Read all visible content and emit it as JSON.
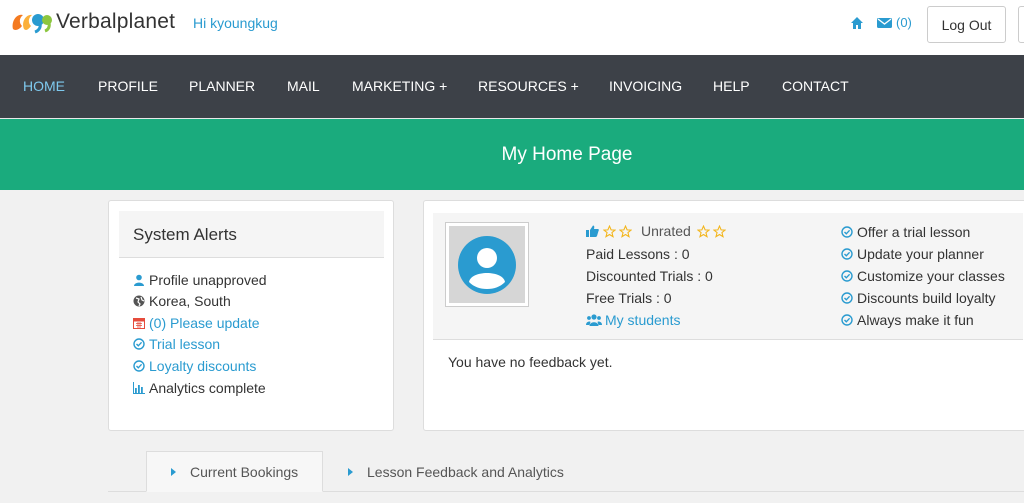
{
  "header": {
    "brand": "Verbalplanet",
    "greeting": "Hi kyoungkug",
    "mail_count": "(0)",
    "logout_label": "Log Out"
  },
  "nav": {
    "items": [
      {
        "label": "HOME"
      },
      {
        "label": "PROFILE"
      },
      {
        "label": "PLANNER"
      },
      {
        "label": "MAIL"
      },
      {
        "label": "MARKETING +"
      },
      {
        "label": "RESOURCES +"
      },
      {
        "label": "INVOICING"
      },
      {
        "label": "HELP"
      },
      {
        "label": "CONTACT"
      }
    ]
  },
  "banner": {
    "title": "My Home Page"
  },
  "alerts": {
    "title": "System Alerts",
    "items": [
      {
        "text": "Profile unapproved",
        "icon": "user-icon"
      },
      {
        "text": "Korea, South",
        "icon": "globe-icon"
      },
      {
        "text": "(0) Please update",
        "icon": "calendar-icon"
      },
      {
        "text": "Trial lesson",
        "icon": "check-circle-icon"
      },
      {
        "text": "Loyalty discounts",
        "icon": "check-circle-icon"
      },
      {
        "text": "Analytics complete",
        "icon": "bar-chart-icon"
      }
    ]
  },
  "profile": {
    "rating_label": "Unrated",
    "stats": [
      {
        "text": "Paid Lessons : 0"
      },
      {
        "text": "Discounted Trials : 0"
      },
      {
        "text": "Free Trials : 0"
      }
    ],
    "students_link": "My students",
    "tips": [
      {
        "text": "Offer a trial lesson"
      },
      {
        "text": "Update your planner"
      },
      {
        "text": "Customize your classes"
      },
      {
        "text": "Discounts build loyalty"
      },
      {
        "text": "Always make it fun"
      }
    ],
    "feedback": "You have no feedback yet."
  },
  "tabs": [
    {
      "label": "Current Bookings"
    },
    {
      "label": "Lesson Feedback and Analytics"
    }
  ],
  "colors": {
    "nav_bg": "#3d4148",
    "banner_bg": "#1aab7d",
    "link": "#2a9bd0",
    "nav_active": "#7ec9ee",
    "star": "#f3b51b"
  }
}
